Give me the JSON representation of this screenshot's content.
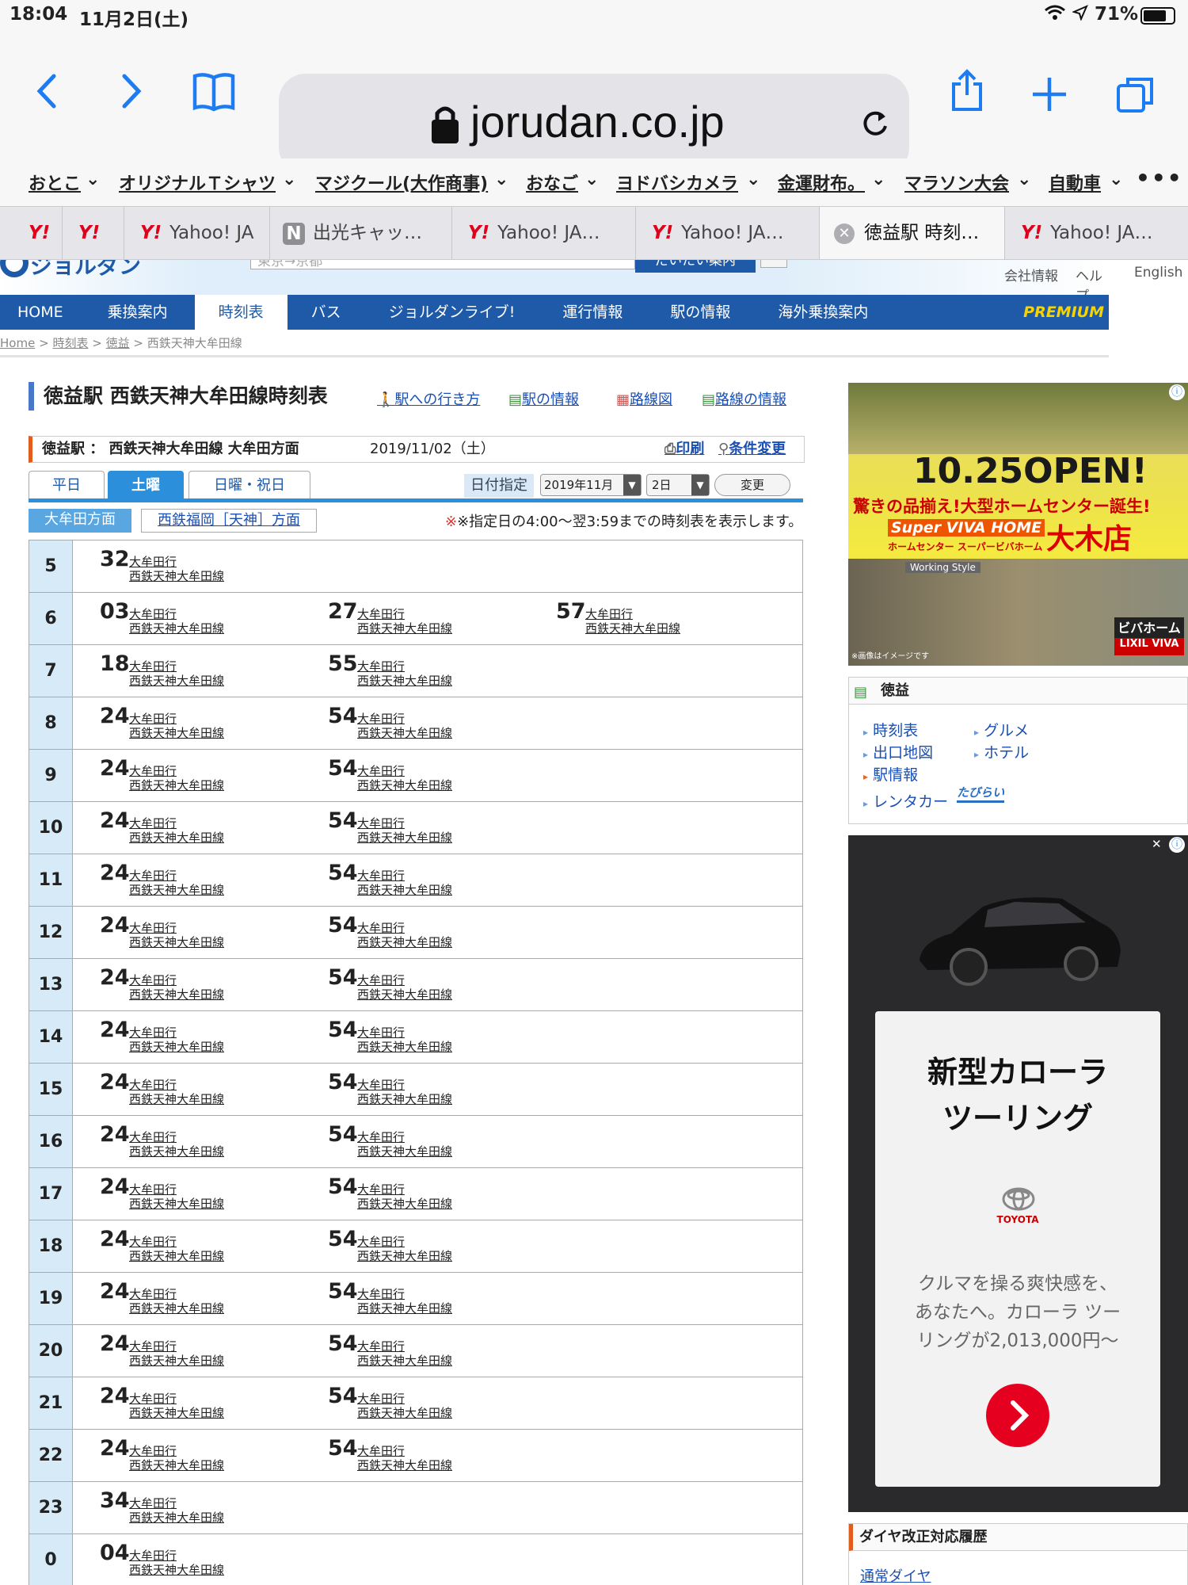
{
  "status": {
    "time": "18:04",
    "date": "11月2日(土)",
    "battery": "71%"
  },
  "browser": {
    "domain": "jorudan.co.jp"
  },
  "bookmarks": [
    "おとこ",
    "オリジナルＴシャツ",
    "マジクール(大作商事)",
    "おなご",
    "ヨドバシカメラ",
    "金運財布。",
    "マラソン大会",
    "自動車"
  ],
  "tabs": [
    {
      "label": "Yahoo! JA",
      "icon": "yahoo"
    },
    {
      "label": "出光キャッ…",
      "icon": "n"
    },
    {
      "label": "Yahoo! JA…",
      "icon": "yahoo"
    },
    {
      "label": "Yahoo! JA…",
      "icon": "yahoo"
    },
    {
      "label": "徳益駅 時刻…",
      "icon": "close",
      "active": true
    },
    {
      "label": "Yahoo! JA…",
      "icon": "yahoo"
    }
  ],
  "header": {
    "logo": "ジョルダン",
    "search_placeholder": "東京→京都",
    "search_button": "だいたい案内",
    "help_q": "?",
    "links": [
      "会社情報",
      "ヘルプ",
      "English"
    ]
  },
  "nav": [
    "HOME",
    "乗換案内",
    "時刻表",
    "バス",
    "ジョルダンライブ!",
    "運行情報",
    "駅の情報",
    "海外乗換案内"
  ],
  "nav_active": "時刻表",
  "premium": "PREMIUM",
  "breadcrumb": {
    "home": "Home",
    "sep": ">",
    "timetable": "時刻表",
    "station": "徳益",
    "line": "西鉄天神大牟田線"
  },
  "title": "徳益駅 西鉄天神大牟田線時刻表",
  "title_links": [
    "駅への行き方",
    "駅の情報",
    "路線図",
    "路線の情報"
  ],
  "subheader": {
    "label": "徳益駅 ： 西鉄天神大牟田線 大牟田方面",
    "date": "2019/11/02（土）",
    "print": "印刷",
    "change": "条件変更"
  },
  "day_tabs": [
    "平日",
    "土曜",
    "日曜・祝日"
  ],
  "day_active": "土曜",
  "date_select": {
    "label": "日付指定",
    "month": "2019年11月",
    "day": "2日",
    "button": "変更"
  },
  "dir_tabs": [
    "大牟田方面",
    "西鉄福岡［天神］方面"
  ],
  "note": "※指定日の4:00～翌3:59までの時刻表を表示します。",
  "dest": "大牟田行",
  "line_name": "西鉄天神大牟田線",
  "timetable": [
    {
      "hour": "5",
      "mins": [
        "32"
      ]
    },
    {
      "hour": "6",
      "mins": [
        "03",
        "27",
        "57"
      ]
    },
    {
      "hour": "7",
      "mins": [
        "18",
        "55"
      ]
    },
    {
      "hour": "8",
      "mins": [
        "24",
        "54"
      ]
    },
    {
      "hour": "9",
      "mins": [
        "24",
        "54"
      ]
    },
    {
      "hour": "10",
      "mins": [
        "24",
        "54"
      ]
    },
    {
      "hour": "11",
      "mins": [
        "24",
        "54"
      ]
    },
    {
      "hour": "12",
      "mins": [
        "24",
        "54"
      ]
    },
    {
      "hour": "13",
      "mins": [
        "24",
        "54"
      ]
    },
    {
      "hour": "14",
      "mins": [
        "24",
        "54"
      ]
    },
    {
      "hour": "15",
      "mins": [
        "24",
        "54"
      ]
    },
    {
      "hour": "16",
      "mins": [
        "24",
        "54"
      ]
    },
    {
      "hour": "17",
      "mins": [
        "24",
        "54"
      ]
    },
    {
      "hour": "18",
      "mins": [
        "24",
        "54"
      ]
    },
    {
      "hour": "19",
      "mins": [
        "24",
        "54"
      ]
    },
    {
      "hour": "20",
      "mins": [
        "24",
        "54"
      ]
    },
    {
      "hour": "21",
      "mins": [
        "24",
        "54"
      ]
    },
    {
      "hour": "22",
      "mins": [
        "24",
        "54"
      ]
    },
    {
      "hour": "23",
      "mins": [
        "34"
      ]
    },
    {
      "hour": "0",
      "mins": [
        "04"
      ]
    }
  ],
  "ad1": {
    "headline": "10.25OPEN!",
    "sub": "驚きの品揃え!大型ホームセンター誕生!",
    "brand": "Super VIVA HOME",
    "brand_kana": "ホームセンター スーパービバホーム",
    "store": "大木店",
    "working": "Working Style",
    "logo": "ビバホーム",
    "logo2": "LIXIL VIVA",
    "note": "※画像はイメージです"
  },
  "station_box": {
    "title": "徳益",
    "links": [
      "時刻表",
      "グルメ",
      "出口地図",
      "ホテル",
      "駅情報",
      "レンタカー"
    ],
    "tabirai": "たびらい"
  },
  "ad2": {
    "title1": "新型カローラ",
    "title2": "ツーリング",
    "brand": "TOYOTA",
    "body": [
      "クルマを操る爽快感を、",
      "あなたへ。カローラ ツー",
      "リングが2,013,000円〜"
    ]
  },
  "revision": {
    "title": "ダイヤ改正対応履歴",
    "link": "通常ダイヤ"
  }
}
